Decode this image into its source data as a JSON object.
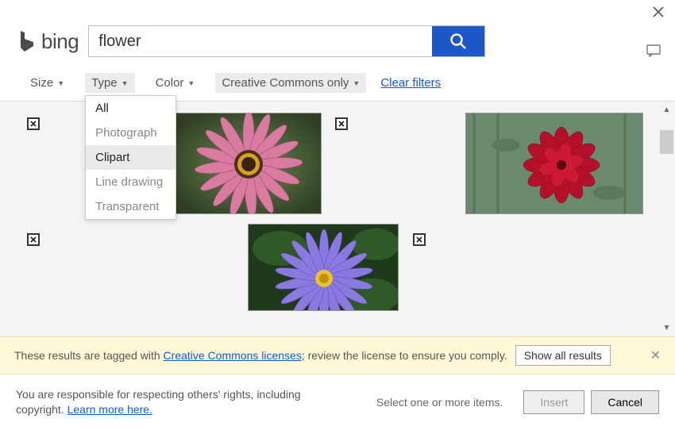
{
  "window": {
    "close_tooltip": "Close",
    "feedback_tooltip": "Feedback"
  },
  "logo": {
    "text": "bing"
  },
  "search": {
    "value": "flower",
    "placeholder": ""
  },
  "filters": {
    "size": {
      "label": "Size"
    },
    "type": {
      "label": "Type",
      "options": [
        "All",
        "Photograph",
        "Clipart",
        "Line drawing",
        "Transparent"
      ],
      "selected": "All",
      "hovered": "Clipart"
    },
    "color": {
      "label": "Color"
    },
    "license": {
      "label": "Creative Commons only"
    },
    "clear": "Clear filters"
  },
  "results": [
    {
      "id": "img1",
      "alt": "Pink coneflower"
    },
    {
      "id": "img2",
      "alt": "Red dahlia"
    },
    {
      "id": "img3",
      "alt": "Small flower"
    },
    {
      "id": "img4",
      "alt": "Purple waterlily"
    },
    {
      "id": "img5",
      "alt": "Flower"
    }
  ],
  "notice": {
    "prefix": "These results are tagged with ",
    "link": "Creative Commons licenses",
    "suffix": "; review the license to ensure you comply.",
    "show_all": "Show all results"
  },
  "footer": {
    "disclaimer_text": "You are responsible for respecting others' rights, including copyright. ",
    "learn_more": "Learn more here.",
    "status": "Select one or more items.",
    "insert": "Insert",
    "cancel": "Cancel"
  }
}
